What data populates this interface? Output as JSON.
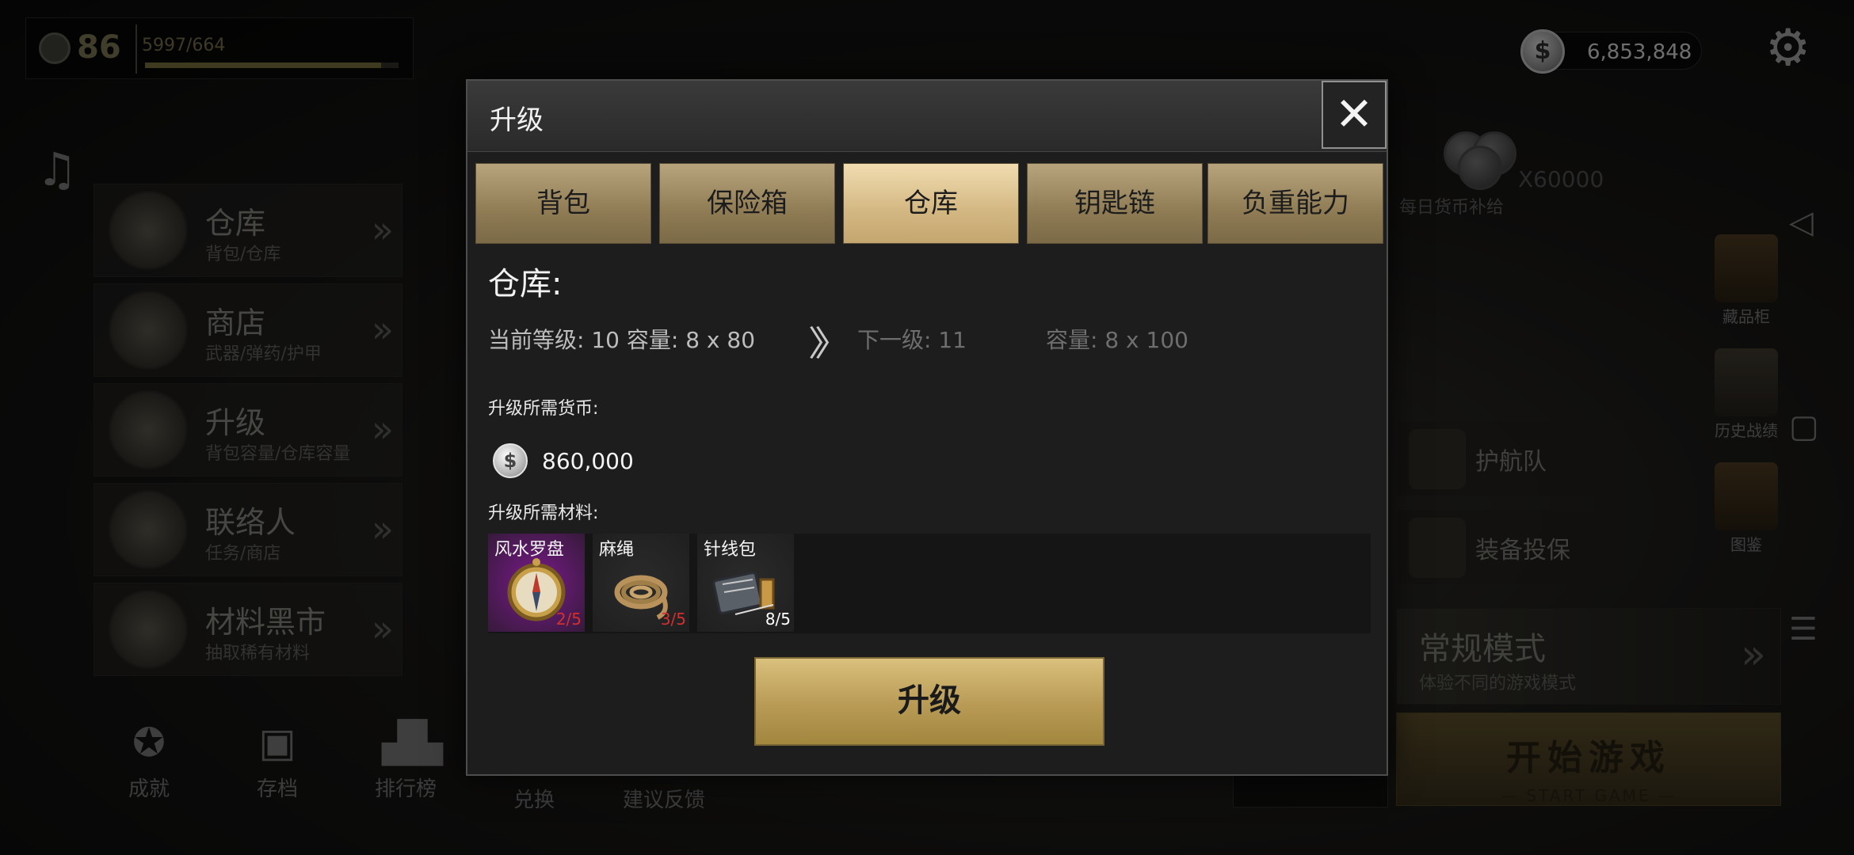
{
  "player": {
    "level": "86",
    "xp_text": "5997/664",
    "xp_fill_fraction": 0.93
  },
  "menu": [
    {
      "title": "仓库",
      "subtitle": "背包/仓库"
    },
    {
      "title": "商店",
      "subtitle": "武器/弹药/护甲"
    },
    {
      "title": "升级",
      "subtitle": "背包容量/仓库容量"
    },
    {
      "title": "联络人",
      "subtitle": "任务/商店"
    },
    {
      "title": "材料黑市",
      "subtitle": "抽取稀有材料"
    }
  ],
  "bottom_nav": [
    {
      "label": "成就",
      "icon": "medal-icon"
    },
    {
      "label": "存档",
      "icon": "save-icon"
    },
    {
      "label": "排行榜",
      "icon": "leaderboard-icon"
    },
    {
      "label": "兑换",
      "icon": "exchange-icon"
    },
    {
      "label": "建议反馈",
      "icon": "feedback-icon"
    }
  ],
  "currency": {
    "amount": "6,853,848",
    "coin_symbol": "$"
  },
  "daily": {
    "multiplier": "X60000",
    "label": "每日货币补给"
  },
  "side_items": [
    {
      "label": "藏品柜",
      "icon": "cabinet-icon"
    },
    {
      "label": "历史战绩",
      "icon": "scroll-icon"
    },
    {
      "label": "图鉴",
      "icon": "book-icon"
    }
  ],
  "team_cards": [
    {
      "label": "护航队",
      "icon": "escort-icon"
    },
    {
      "label": "装备投保",
      "icon": "shield-icon"
    }
  ],
  "mode": {
    "title": "常规模式",
    "subtitle": "体验不同的游戏模式"
  },
  "start": {
    "title": "开始游戏",
    "subtitle": "— START GAME —"
  },
  "dialog": {
    "title": "升级",
    "close_glyph": "✕",
    "tabs": [
      {
        "label": "背包",
        "active": false
      },
      {
        "label": "保险箱",
        "active": false
      },
      {
        "label": "仓库",
        "active": true
      },
      {
        "label": "钥匙链",
        "active": false
      },
      {
        "label": "负重能力",
        "active": false
      }
    ],
    "section_title": "仓库:",
    "current_level_text": "当前等级: 10 容量: 8 x 80",
    "arrow_glyph": "〉〉",
    "next_level_text": "下一级: 11",
    "next_capacity_text": "容量: 8 x 100",
    "currency_heading": "升级所需货币:",
    "currency_amount": "860,000",
    "materials_heading": "升级所需材料:",
    "materials": [
      {
        "name": "风水罗盘",
        "count": "2/5",
        "sufficient": false,
        "icon": "compass-icon",
        "bg": "#7a1a8a"
      },
      {
        "name": "麻绳",
        "count": "3/5",
        "sufficient": false,
        "icon": "rope-icon",
        "bg": "#2b2b2b"
      },
      {
        "name": "针线包",
        "count": "8/5",
        "sufficient": true,
        "icon": "sewing-kit-icon",
        "bg": "#2b2b2b"
      }
    ],
    "upgrade_label": "升级"
  },
  "system_buttons": [
    "back-icon",
    "recent-apps-icon",
    "menu-icon"
  ],
  "colors": {
    "tab_active": "#d3b782",
    "tab_inactive": "#8f7c55",
    "insufficient": "#d23030",
    "upgrade_button": "#b89a55"
  }
}
